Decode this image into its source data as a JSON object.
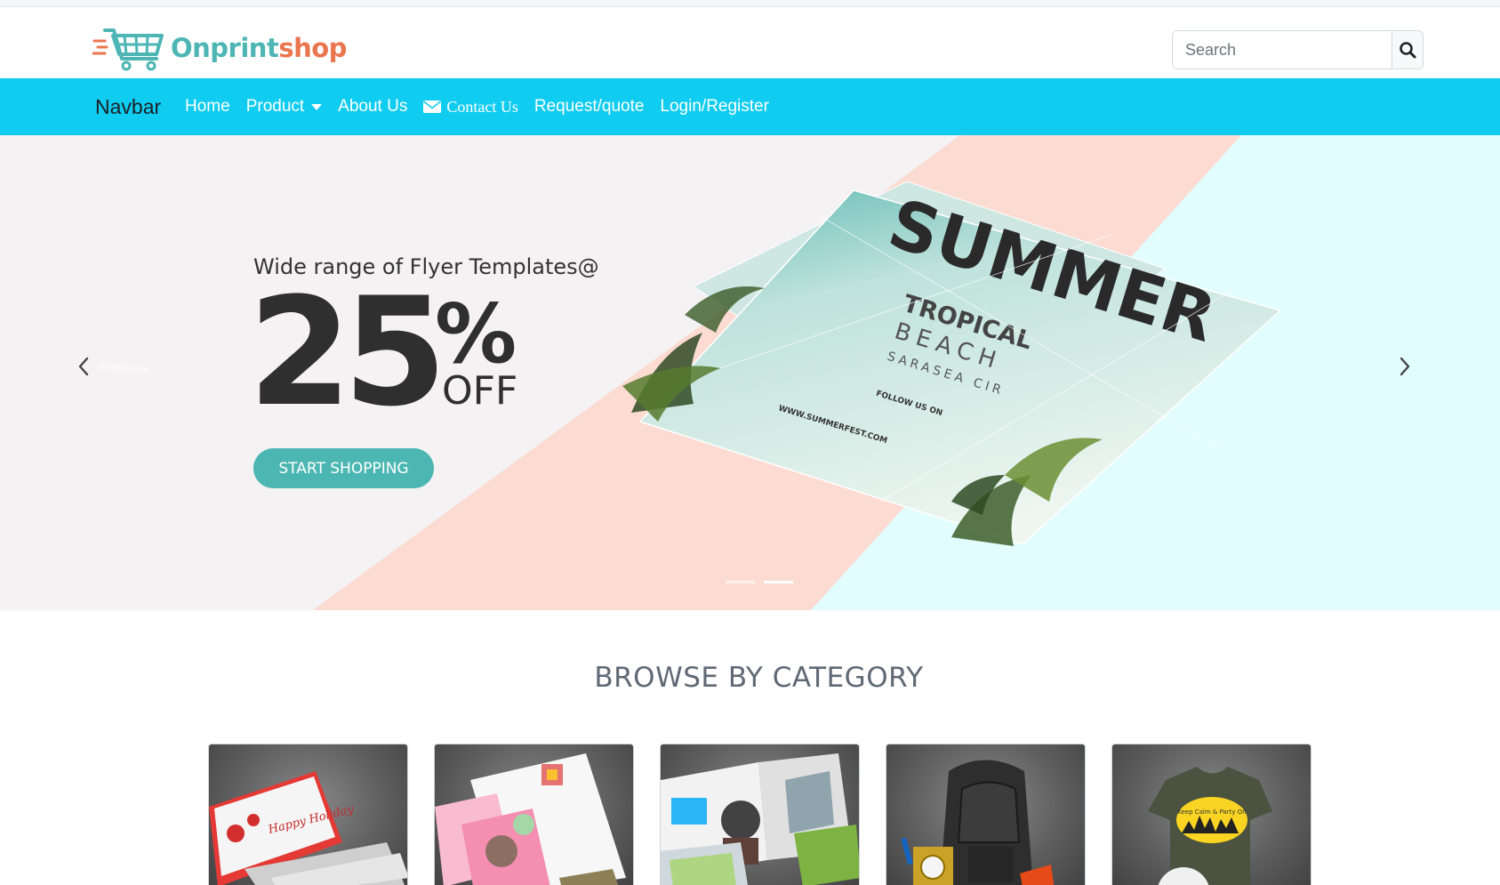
{
  "header": {
    "logo_part1": "Onprint",
    "logo_part2": "shop",
    "search_placeholder": "Search",
    "logo_icon": "shopping-cart-icon",
    "search_icon": "search-icon"
  },
  "navbar": {
    "brand": "Navbar",
    "items": [
      {
        "label": "Home"
      },
      {
        "label": "Product"
      },
      {
        "label": "About Us"
      },
      {
        "label": "Contact Us"
      },
      {
        "label": "Request/quote"
      },
      {
        "label": "Login/Register"
      }
    ],
    "color": "#10ccf1"
  },
  "hero": {
    "subtitle": "Wide range of Flyer Templates@",
    "discount_number": "25",
    "discount_symbol": "%",
    "discount_word": "OFF",
    "cta_label": "START SHOPPING",
    "prev_label": "Previous",
    "flyer_headline": "SUMMER",
    "flyer_sub1": "TROPICAL",
    "flyer_sub2": "BEACH",
    "flyer_sub3": "SARASEA CIR",
    "flyer_follow": "FOLLOW US ON",
    "flyer_url": "WWW.SUMMERFEST.COM",
    "slide_count": 2,
    "active_slide": 2,
    "accent": "#4cb7b2"
  },
  "browse": {
    "title": "BROWSE BY CATEGORY",
    "categories": [
      {
        "name": "business-cards",
        "card_text": "Happy Holiday"
      },
      {
        "name": "stationery"
      },
      {
        "name": "brochures"
      },
      {
        "name": "promotional-products"
      },
      {
        "name": "apparel",
        "card_text": "Keep Calm & Party On"
      }
    ]
  }
}
